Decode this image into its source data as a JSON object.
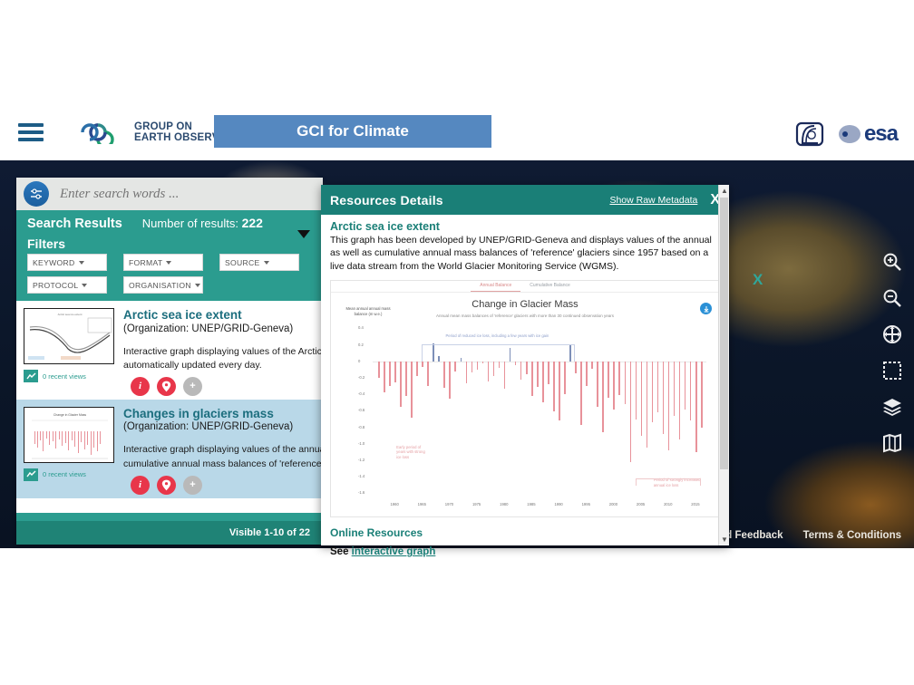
{
  "header": {
    "menu_icon": "hamburger-icon",
    "logo": {
      "line1": "GROUP ON",
      "line2": "EARTH OBSERVATIONS",
      "mark": "geo-logo-icon"
    },
    "app_title": "GCI for Climate",
    "partner_logos": [
      {
        "name": "unep-grid-geneva-logo",
        "label": ""
      },
      {
        "name": "esa-logo",
        "label": "esa"
      }
    ]
  },
  "map": {
    "marker_label": "X",
    "controls": [
      {
        "name": "zoom-in-icon",
        "label": "Zoom in"
      },
      {
        "name": "zoom-out-icon",
        "label": "Zoom out"
      },
      {
        "name": "pan-icon",
        "label": "Pan"
      },
      {
        "name": "select-area-icon",
        "label": "Select area"
      },
      {
        "name": "layers-icon",
        "label": "Layers"
      },
      {
        "name": "legend-icon",
        "label": "Legend"
      }
    ],
    "footer_links": [
      "Send Feedback",
      "Terms & Conditions"
    ]
  },
  "search_panel": {
    "search_placeholder": "Enter search words ...",
    "search_value": "",
    "results_label": "Search Results",
    "count_prefix": "Number of results:",
    "count_value": "222",
    "filters_label": "Filters",
    "filters": [
      "KEYWORD",
      "FORMAT",
      "SOURCE",
      "PROTOCOL",
      "ORGANISATION"
    ],
    "pagination": "Visible 1-10 of 22",
    "results": [
      {
        "title": "Arctic sea ice extent",
        "organization": "(Organization: UNEP/GRID-Geneva)",
        "description_line1": "Interactive graph displaying values of the Arctic sea",
        "description_line2": "automatically updated every day.",
        "views": "0 recent views",
        "selected": false,
        "actions": [
          "info-icon",
          "pin-icon",
          "add-icon"
        ]
      },
      {
        "title": "Changes in glaciers mass",
        "organization": "(Organization: UNEP/GRID-Geneva)",
        "description_line1": "Interactive graph displaying values of the annual a",
        "description_line2": "cumulative annual mass balances of 'reference' gl",
        "views": "0 recent views",
        "selected": true,
        "actions": [
          "info-icon",
          "pin-icon",
          "add-icon"
        ]
      }
    ]
  },
  "modal": {
    "title": "Resources Details",
    "raw_metadata_link": "Show Raw Metadata",
    "close_label": "X",
    "resource_title": "Arctic sea ice extent",
    "description": "This graph has been developed by UNEP/GRID-Geneva and displays values of the annual as well as cumulative annual mass balances of 'reference' glaciers since 1957 based on a live data stream from the World Glacier Monitoring Service (WGMS).",
    "online_resources_heading": "Online Resources",
    "online_resources_prefix": "See",
    "online_resources_link": "interactive graph",
    "download_icon": "download-icon"
  },
  "chart_data": {
    "type": "bar",
    "title": "Change in Glacier Mass",
    "subtitle": "Annual mean mass balances of 'reference' glaciers with more than 30 continued observation years",
    "tabs": [
      "Annual Balance",
      "Cumulative Balance"
    ],
    "active_tab": "Annual Balance",
    "ylabel": "Mean annual annual mass balance (m w.e.)",
    "xlabel": "",
    "ylim": [
      -1.6,
      0.4
    ],
    "yticks": [
      0.4,
      0.2,
      0,
      -0.2,
      -0.4,
      -0.6,
      -0.8,
      -1.0,
      -1.2,
      -1.4,
      -1.6
    ],
    "ytick_labels": [
      "0.4",
      "0.2",
      "0",
      "-0.2",
      "-0.4",
      "-0.6",
      "-0.8",
      "-1.0",
      "-1.2",
      "-1.4",
      "-1.6"
    ],
    "xticks": [
      1960,
      1965,
      1970,
      1975,
      1980,
      1985,
      1990,
      1995,
      2000,
      2005,
      2010,
      2015
    ],
    "xtick_labels": [
      "1960",
      "1965",
      "1970",
      "1975",
      "1980",
      "1985",
      "1990",
      "1995",
      "2000",
      "2005",
      "2010",
      "2015"
    ],
    "grid": false,
    "bar_color_negative": "#e8929a",
    "bar_color_positive": "#7d8fb8",
    "annotations": [
      {
        "text": "Period of reduced ice loss, including a few years with ice gain",
        "color": "#8d9ec9",
        "x": 1970,
        "y": 0.25
      },
      {
        "text": "Early period of years with strong ice loss",
        "color": "#e5a0a4",
        "x": 1961,
        "y": -1.1
      },
      {
        "text": "Period of strongly increased annual ice loss",
        "color": "#e5a0a4",
        "x": 2008,
        "y": -1.5
      }
    ],
    "x": [
      1957,
      1958,
      1959,
      1960,
      1961,
      1962,
      1963,
      1964,
      1965,
      1966,
      1967,
      1968,
      1969,
      1970,
      1971,
      1972,
      1973,
      1974,
      1975,
      1976,
      1977,
      1978,
      1979,
      1980,
      1981,
      1982,
      1983,
      1984,
      1985,
      1986,
      1987,
      1988,
      1989,
      1990,
      1991,
      1992,
      1993,
      1994,
      1995,
      1996,
      1997,
      1998,
      1999,
      2000,
      2001,
      2002,
      2003,
      2004,
      2005,
      2006,
      2007,
      2008,
      2009,
      2010,
      2011,
      2012,
      2013,
      2014,
      2015,
      2016
    ],
    "values": [
      -0.2,
      -0.38,
      -0.3,
      -0.25,
      -0.55,
      -0.42,
      -0.68,
      -0.18,
      -0.07,
      -0.3,
      0.22,
      0.06,
      -0.32,
      -0.45,
      -0.12,
      0.04,
      -0.26,
      -0.13,
      -0.1,
      -0.02,
      -0.24,
      -0.18,
      -0.08,
      -0.33,
      0.16,
      -0.05,
      -0.22,
      -0.16,
      -0.42,
      -0.31,
      -0.5,
      -0.28,
      -0.61,
      -0.72,
      -0.4,
      0.2,
      -0.14,
      -0.77,
      -0.3,
      -0.09,
      -0.55,
      -0.86,
      -0.44,
      -0.58,
      -0.41,
      -0.52,
      -1.22,
      -0.7,
      -0.9,
      -1.05,
      -0.74,
      -0.62,
      -0.88,
      -1.08,
      -0.66,
      -0.95,
      -0.58,
      -0.72,
      -1.1,
      -0.8
    ]
  }
}
